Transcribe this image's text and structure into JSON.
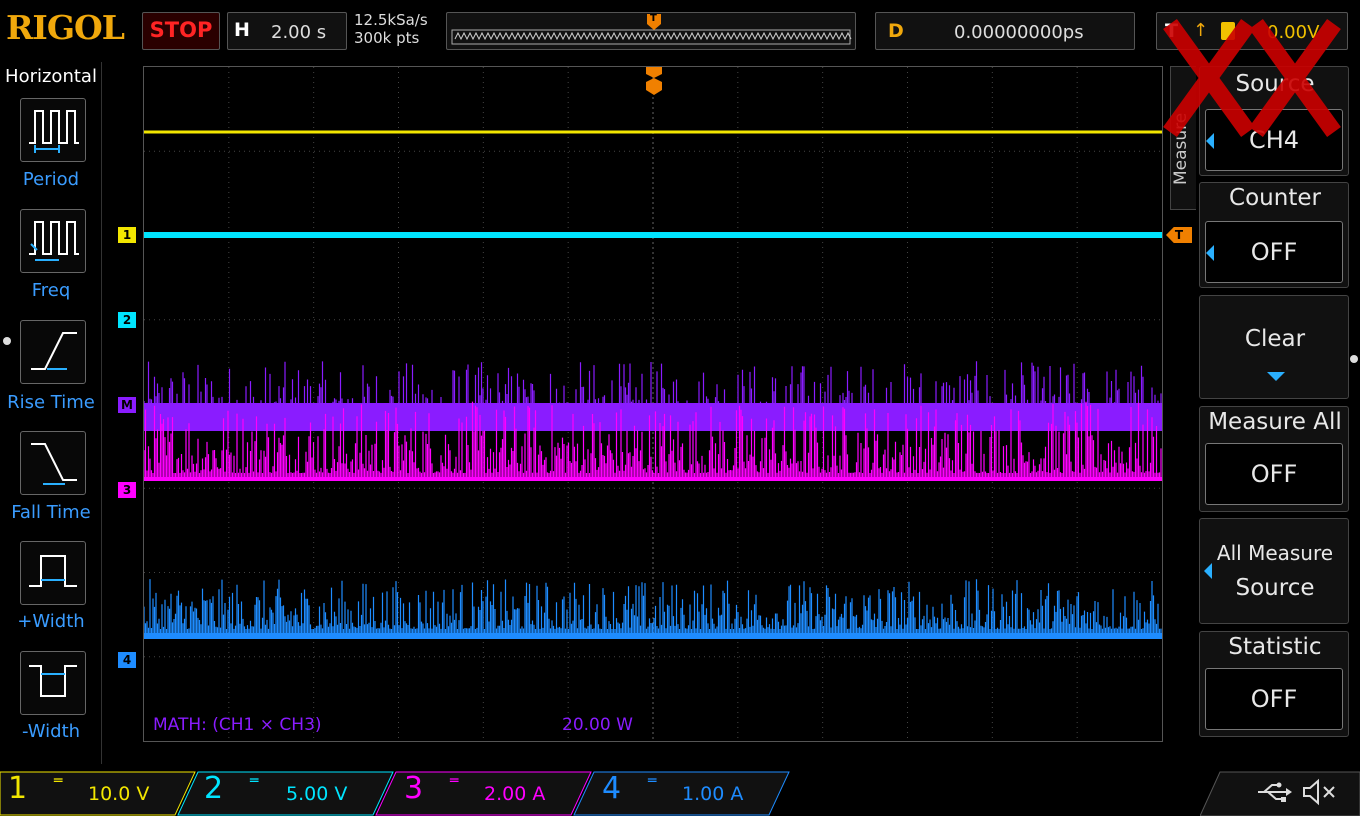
{
  "header": {
    "logo": "RIGOL",
    "run_state": "STOP",
    "horizontal_label": "H",
    "timebase": "2.00 s",
    "sample_rate": "12.5kSa/s",
    "memory_depth": "300k pts",
    "delay_label": "D",
    "delay_value": "0.00000000ps",
    "trigger_label": "T",
    "trigger_level": "0.00V",
    "trigger_marker": "T"
  },
  "left_menu": {
    "title": "Horizontal",
    "items": [
      {
        "label": "Period",
        "icon": "period-icon"
      },
      {
        "label": "Freq",
        "icon": "frequency-icon"
      },
      {
        "label": "Rise Time",
        "icon": "rise-time-icon"
      },
      {
        "label": "Fall Time",
        "icon": "fall-time-icon"
      },
      {
        "label": "+Width",
        "icon": "positive-width-icon"
      },
      {
        "label": "-Width",
        "icon": "negative-width-icon"
      }
    ]
  },
  "right_menu": {
    "tab_label": "Measure",
    "source": {
      "title": "Source",
      "value": "CH4"
    },
    "counter": {
      "title": "Counter",
      "value": "OFF"
    },
    "clear": {
      "title": "Clear"
    },
    "measure_all": {
      "title": "Measure All",
      "value": "OFF"
    },
    "all_measure_source": {
      "title_line1": "All Measure",
      "title_line2": "Source"
    },
    "statistic": {
      "title": "Statistic",
      "value": "OFF"
    }
  },
  "screen": {
    "math_label": "MATH: (CH1 × CH3)",
    "math_scale": "20.00 W",
    "markers": {
      "ch1": "1",
      "ch2": "2",
      "math": "M",
      "ch3": "3",
      "ch4": "4",
      "trigger_right": "T"
    }
  },
  "channels": [
    {
      "num": "1",
      "scale": "10.0 V",
      "color": "#f2e600"
    },
    {
      "num": "2",
      "scale": "5.00 V",
      "color": "#00e5ff"
    },
    {
      "num": "3",
      "scale": "2.00 A",
      "color": "#ff00ff"
    },
    {
      "num": "4",
      "scale": "1.00 A",
      "color": "#1e8cff"
    }
  ],
  "trace_colors": {
    "ch1": "#f2e600",
    "ch2": "#00e5ff",
    "math": "#8a1cff",
    "ch3": "#ff00ff",
    "ch4": "#1e8cff"
  },
  "status_icons": [
    "usb-icon",
    "speaker-muted-icon"
  ],
  "watermark": "XX"
}
